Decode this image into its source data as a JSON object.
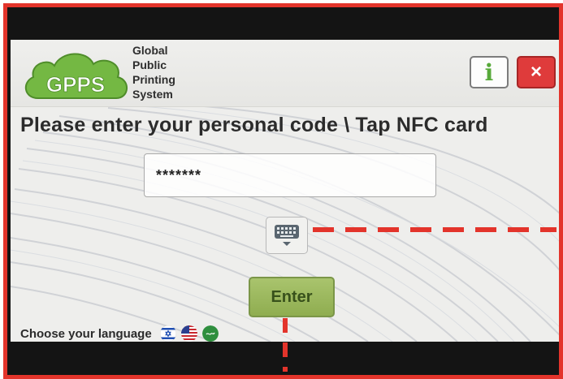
{
  "header": {
    "logo_text": "GPPS",
    "logo_lines": [
      "Global",
      "Public",
      "Printing",
      "System"
    ],
    "info_label": "i",
    "close_label": "×"
  },
  "prompt": "Please enter your personal code \\ Tap NFC card",
  "code_field": {
    "value": "*******"
  },
  "keyboard_icon": "keyboard-icon",
  "enter_label": "Enter",
  "language": {
    "label": "Choose your language",
    "flags": [
      "israel-flag-icon",
      "usa-flag-icon",
      "arabic-language-icon"
    ]
  },
  "colors": {
    "frame_red": "#e3342b",
    "logo_green": "#6fb43f",
    "enter_green": "#9bb75d",
    "close_red": "#df3b3b"
  }
}
